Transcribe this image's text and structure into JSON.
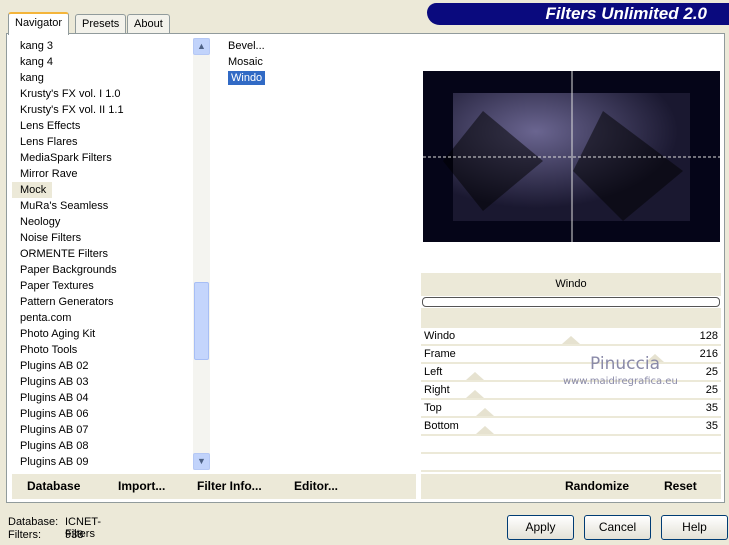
{
  "title": "Filters Unlimited 2.0",
  "tabs": [
    "Navigator",
    "Presets",
    "About"
  ],
  "categories": [
    "kang 3",
    "kang 4",
    "kang",
    "Krusty's FX vol. I 1.0",
    "Krusty's FX vol. II 1.1",
    "Lens Effects",
    "Lens Flares",
    "MediaSpark Filters",
    "Mirror Rave",
    "Mock",
    "MuRa's Seamless",
    "Neology",
    "Noise Filters",
    "ORMENTE Filters",
    "Paper Backgrounds",
    "Paper Textures",
    "Pattern Generators",
    "penta.com",
    "Photo Aging Kit",
    "Photo Tools",
    "Plugins AB 02",
    "Plugins AB 03",
    "Plugins AB 04",
    "Plugins AB 06",
    "Plugins AB 07",
    "Plugins AB 08",
    "Plugins AB 09"
  ],
  "selected_category": "Mock",
  "filters": [
    "Bevel...",
    "Mosaic",
    "Windo"
  ],
  "selected_filter": "Windo",
  "filter_title": "Windo",
  "params": [
    {
      "label": "Windo",
      "value": "128",
      "frac": 0.5
    },
    {
      "label": "Frame",
      "value": "216",
      "frac": 0.85
    },
    {
      "label": "Left",
      "value": "25",
      "frac": 0.1
    },
    {
      "label": "Right",
      "value": "25",
      "frac": 0.1
    },
    {
      "label": "Top",
      "value": "35",
      "frac": 0.14
    },
    {
      "label": "Bottom",
      "value": "35",
      "frac": 0.14
    }
  ],
  "watermark": {
    "name": "Pinuccia",
    "url": "www.maidiregrafica.eu"
  },
  "toolbar": {
    "database": "Database",
    "import": "Import...",
    "filter_info": "Filter Info...",
    "editor": "Editor...",
    "randomize": "Randomize",
    "reset": "Reset"
  },
  "status": {
    "db_label": "Database:",
    "db_value": "ICNET-Filters",
    "filters_label": "Filters:",
    "filters_value": "938"
  },
  "buttons": {
    "apply": "Apply",
    "cancel": "Cancel",
    "help": "Help"
  }
}
